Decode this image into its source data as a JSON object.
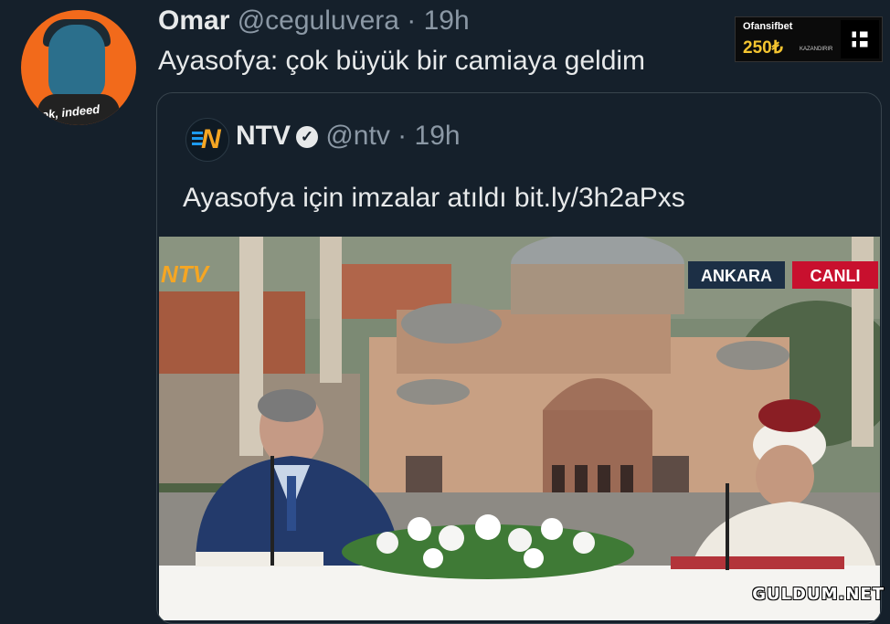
{
  "tweet": {
    "author_name": "Omar",
    "author_handle": "@ceguluvera",
    "separator": "·",
    "time": "19h",
    "text": "Ayasofya: çok büyük bir camiaya geldim",
    "avatar_caption": "ok, indeed"
  },
  "quoted_tweet": {
    "author_name": "NTV",
    "author_handle": "@ntv",
    "separator": "·",
    "time": "19h",
    "text": "Ayasofya için imzalar atıldı bit.ly/3h2aPxs",
    "image": {
      "logo_text": "NTV",
      "location_tag": "ANKARA",
      "live_tag": "CANLI"
    }
  },
  "ad_badge": {
    "brand": "Ofansifbet",
    "amount": "250₺",
    "sub": "KAZANDIRIR"
  },
  "watermark": "GULDUM.NET",
  "colors": {
    "background": "#15202b",
    "text": "#e7e9ea",
    "secondary": "#8b98a5",
    "avatar": "#f26a1b"
  }
}
